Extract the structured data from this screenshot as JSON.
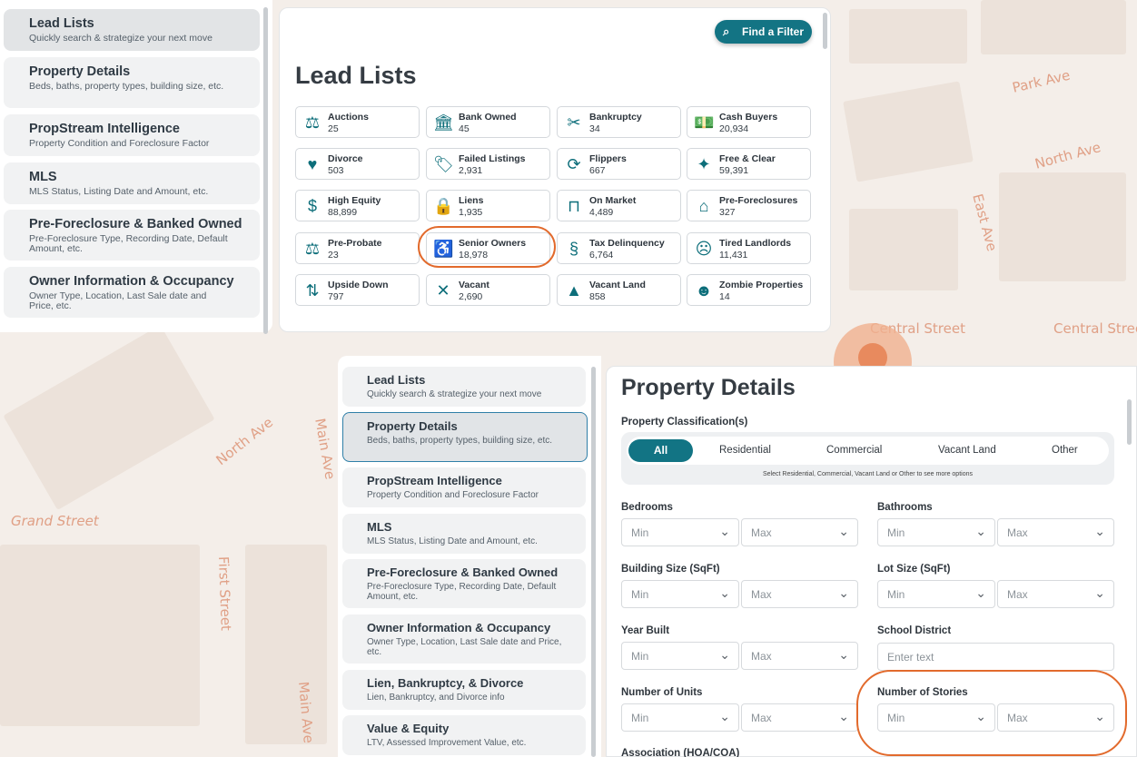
{
  "map": {
    "streets": [
      "Park Ave",
      "North Ave",
      "East Ave",
      "Central Street",
      "Central Street",
      "North Ave",
      "Main Ave",
      "Grand Street",
      "First Street",
      "Main Ave"
    ]
  },
  "top": {
    "sidebar": [
      {
        "title": "Lead Lists",
        "sub": "Quickly search & strategize your next move"
      },
      {
        "title": "Property Details",
        "sub": "Beds, baths, property types, building size, etc."
      },
      {
        "title": "PropStream Intelligence",
        "sub": "Property Condition and Foreclosure Factor"
      },
      {
        "title": "MLS",
        "sub": "MLS Status, Listing Date and Amount, etc."
      },
      {
        "title": "Pre-Foreclosure & Banked Owned",
        "sub": "Pre-Foreclosure Type, Recording Date, Default Amount, etc."
      },
      {
        "title": "Owner Information & Occupancy",
        "sub": "Owner Type, Location, Last Sale date and Price, etc."
      }
    ],
    "find_filter_label": "Find a Filter",
    "heading": "Lead Lists",
    "tiles": [
      {
        "name": "Auctions",
        "count": "25",
        "icon": "gavel-icon",
        "glyph": "⚖"
      },
      {
        "name": "Bank Owned",
        "count": "45",
        "icon": "bank-icon",
        "glyph": "🏛"
      },
      {
        "name": "Bankruptcy",
        "count": "34",
        "icon": "broken-piggy-icon",
        "glyph": "✂"
      },
      {
        "name": "Cash Buyers",
        "count": "20,934",
        "icon": "cash-icon",
        "glyph": "💵"
      },
      {
        "name": "Divorce",
        "count": "503",
        "icon": "divorce-icon",
        "glyph": "♥"
      },
      {
        "name": "Failed Listings",
        "count": "2,931",
        "icon": "tag-icon",
        "glyph": "🏷"
      },
      {
        "name": "Flippers",
        "count": "667",
        "icon": "refresh-icon",
        "glyph": "⟳"
      },
      {
        "name": "Free & Clear",
        "count": "59,391",
        "icon": "sparkle-icon",
        "glyph": "✦"
      },
      {
        "name": "High Equity",
        "count": "88,899",
        "icon": "money-bag-icon",
        "glyph": "$"
      },
      {
        "name": "Liens",
        "count": "1,935",
        "icon": "lock-icon",
        "glyph": "🔒"
      },
      {
        "name": "On Market",
        "count": "4,489",
        "icon": "sign-icon",
        "glyph": "⊓"
      },
      {
        "name": "Pre-Foreclosures",
        "count": "327",
        "icon": "broken-house-icon",
        "glyph": "⌂"
      },
      {
        "name": "Pre-Probate",
        "count": "23",
        "icon": "scales-icon",
        "glyph": "⚖"
      },
      {
        "name": "Senior Owners",
        "count": "18,978",
        "icon": "senior-icon",
        "glyph": "♿"
      },
      {
        "name": "Tax Delinquency",
        "count": "6,764",
        "icon": "tax-icon",
        "glyph": "§"
      },
      {
        "name": "Tired Landlords",
        "count": "11,431",
        "icon": "tired-face-icon",
        "glyph": "☹"
      },
      {
        "name": "Upside Down",
        "count": "797",
        "icon": "upside-down-icon",
        "glyph": "⇅"
      },
      {
        "name": "Vacant",
        "count": "2,690",
        "icon": "vacant-icon",
        "glyph": "✕"
      },
      {
        "name": "Vacant Land",
        "count": "858",
        "icon": "land-icon",
        "glyph": "▲"
      },
      {
        "name": "Zombie Properties",
        "count": "14",
        "icon": "zombie-icon",
        "glyph": "☻"
      }
    ]
  },
  "bottom": {
    "sidebar": [
      {
        "title": "Lead Lists",
        "sub": "Quickly search & strategize your next move"
      },
      {
        "title": "Property Details",
        "sub": "Beds, baths, property types, building size, etc."
      },
      {
        "title": "PropStream Intelligence",
        "sub": "Property Condition and Foreclosure Factor"
      },
      {
        "title": "MLS",
        "sub": "MLS Status, Listing Date and Amount, etc."
      },
      {
        "title": "Pre-Foreclosure & Banked Owned",
        "sub": "Pre-Foreclosure Type, Recording Date, Default Amount, etc."
      },
      {
        "title": "Owner Information & Occupancy",
        "sub": "Owner Type, Location, Last Sale date and Price, etc."
      },
      {
        "title": "Lien, Bankruptcy, & Divorce",
        "sub": "Lien, Bankruptcy, and Divorce info"
      },
      {
        "title": "Value & Equity",
        "sub": "LTV, Assessed Improvement Value, etc."
      }
    ],
    "heading": "Property Details",
    "classification_label": "Property Classification(s)",
    "classifications": [
      "All",
      "Residential",
      "Commercial",
      "Vacant Land",
      "Other"
    ],
    "classification_note": "Select Residential, Commercial, Vacant Land or Other to see more options",
    "fields": {
      "bedrooms": "Bedrooms",
      "bathrooms": "Bathrooms",
      "building_size": "Building Size (SqFt)",
      "lot_size": "Lot Size (SqFt)",
      "year_built": "Year Built",
      "school_district": "School District",
      "units": "Number of Units",
      "stories": "Number of Stories",
      "association": "Association (HOA/COA)"
    },
    "min_label": "Min",
    "max_label": "Max",
    "school_placeholder": "Enter text"
  },
  "colors": {
    "accent": "#127484",
    "highlight": "#e26a2c"
  }
}
